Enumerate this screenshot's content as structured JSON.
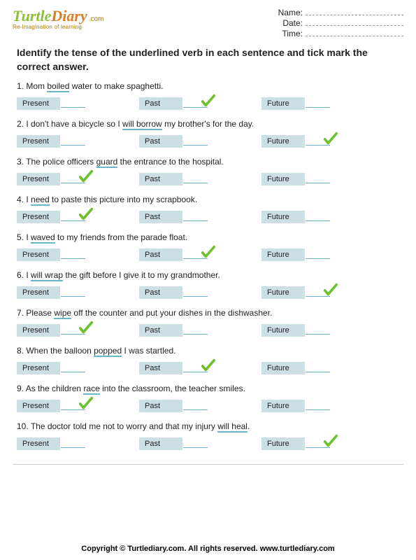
{
  "logo": {
    "part1": "Turtle",
    "part2": "Diary",
    "domain": ".com",
    "tagline": "Re-Imagination of learning"
  },
  "info": {
    "name_label": "Name:",
    "date_label": "Date:",
    "time_label": "Time:"
  },
  "instructions": "Identify the tense of the underlined verb in each sentence and tick mark the correct answer.",
  "labels": {
    "present": "Present",
    "past": "Past",
    "future": "Future"
  },
  "questions": [
    {
      "n": "1.",
      "pre": "Mom ",
      "u": "boiled",
      "post": " water to make spaghetti.",
      "ans": 1
    },
    {
      "n": "2.",
      "pre": "I don't have a bicycle so I ",
      "u": "will borrow",
      "post": " my brother's for the day.",
      "ans": 2
    },
    {
      "n": "3.",
      "pre": "The police officers ",
      "u": "guard",
      "post": " the entrance to the hospital.",
      "ans": 0
    },
    {
      "n": "4.",
      "pre": "I ",
      "u": "need",
      "post": " to paste this picture into my scrapbook.",
      "ans": 0
    },
    {
      "n": "5.",
      "pre": "I ",
      "u": "waved",
      "post": " to my friends from the parade float.",
      "ans": 1
    },
    {
      "n": "6.",
      "pre": "I ",
      "u": "will wrap",
      "post": " the gift before I give it to my grandmother.",
      "ans": 2
    },
    {
      "n": "7.",
      "pre": "Please ",
      "u": "wipe",
      "post": " off the counter and put your dishes in the dishwasher.",
      "ans": 0
    },
    {
      "n": "8.",
      "pre": "When the balloon ",
      "u": "popped",
      "post": " I was startled.",
      "ans": 1
    },
    {
      "n": "9.",
      "pre": "As the children ",
      "u": "race",
      "post": " into the classroom, the teacher smiles.",
      "ans": 0
    },
    {
      "n": "10.",
      "pre": "The doctor told me not to worry and that my injury ",
      "u": "will heal",
      "post": ".",
      "ans": 2
    }
  ],
  "footer": "Copyright © Turtlediary.com. All rights reserved. www.turtlediary.com"
}
